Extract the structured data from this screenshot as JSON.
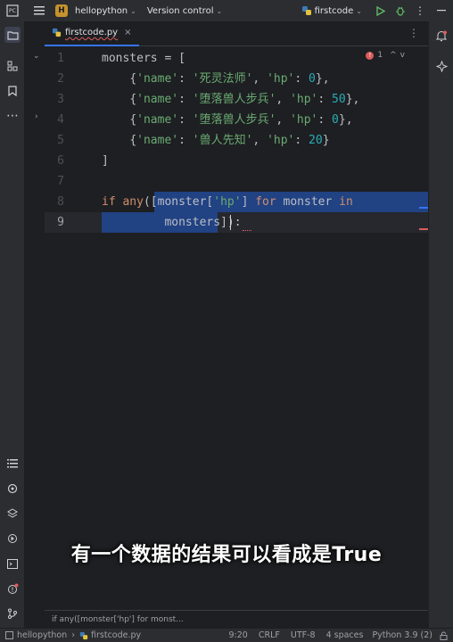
{
  "titlebar": {
    "project_badge": "H",
    "project_name": "hellopython",
    "vcs_label": "Version control",
    "run_config": "firstcode"
  },
  "tab": {
    "filename": "firstcode.py",
    "close": "×",
    "more": "⋮"
  },
  "inspection": {
    "error_count": "1",
    "up": "^",
    "down": "v"
  },
  "line_numbers": [
    "1",
    "2",
    "3",
    "4",
    "5",
    "6",
    "7",
    "8",
    "9"
  ],
  "code": {
    "l1": "monsters = [",
    "l2": {
      "indent": "    ",
      "open": "{",
      "k1": "'name'",
      "c1": ": ",
      "v1": "'死灵法师'",
      "sep": ", ",
      "k2": "'hp'",
      "c2": ": ",
      "v2": "0",
      "close": "},"
    },
    "l3": {
      "indent": "    ",
      "open": "{",
      "k1": "'name'",
      "c1": ": ",
      "v1": "'堕落兽人步兵'",
      "sep": ", ",
      "k2": "'hp'",
      "c2": ": ",
      "v2": "50",
      "close": "},"
    },
    "l4": {
      "indent": "    ",
      "open": "{",
      "k1": "'name'",
      "c1": ": ",
      "v1": "'堕落兽人步兵'",
      "sep": ", ",
      "k2": "'hp'",
      "c2": ": ",
      "v2": "0",
      "close": "},"
    },
    "l5": {
      "indent": "    ",
      "open": "{",
      "k1": "'name'",
      "c1": ": ",
      "v1": "'兽人先知'",
      "sep": ", ",
      "k2": "'hp'",
      "c2": ": ",
      "v2": "20",
      "close": "}"
    },
    "l6": "]",
    "l8": {
      "kw_if": "if",
      "sp": " ",
      "fn_any": "any",
      "paren": "(",
      "bracket": "[",
      "var": "monster",
      "idx_open": "[",
      "key": "'hp'",
      "idx_close": "]",
      "sp2": " ",
      "kw_for": "for",
      "sp3": " ",
      "var2": "monster",
      "sp4": " ",
      "kw_in": "in"
    },
    "l9": {
      "indent": "         ",
      "var": "monsters",
      "bracket_close": "]",
      "paren_close": ")",
      "colon": ":"
    }
  },
  "subtitle": "有一个数据的结果可以看成是True",
  "breadcrumb": "if any([monster['hp'] for monst...",
  "statusbar": {
    "project": "hellopython",
    "file": "firstcode.py",
    "position": "9:20",
    "line_sep": "CRLF",
    "encoding": "UTF-8",
    "indent": "4 spaces",
    "interpreter": "Python 3.9 (2)"
  },
  "colors": {
    "background": "#1e1f22",
    "keyword": "#cf8e6d",
    "string": "#6aab73",
    "number": "#2aacb8",
    "selection": "#214283",
    "accent": "#3574f0",
    "error": "#db5c5c"
  }
}
